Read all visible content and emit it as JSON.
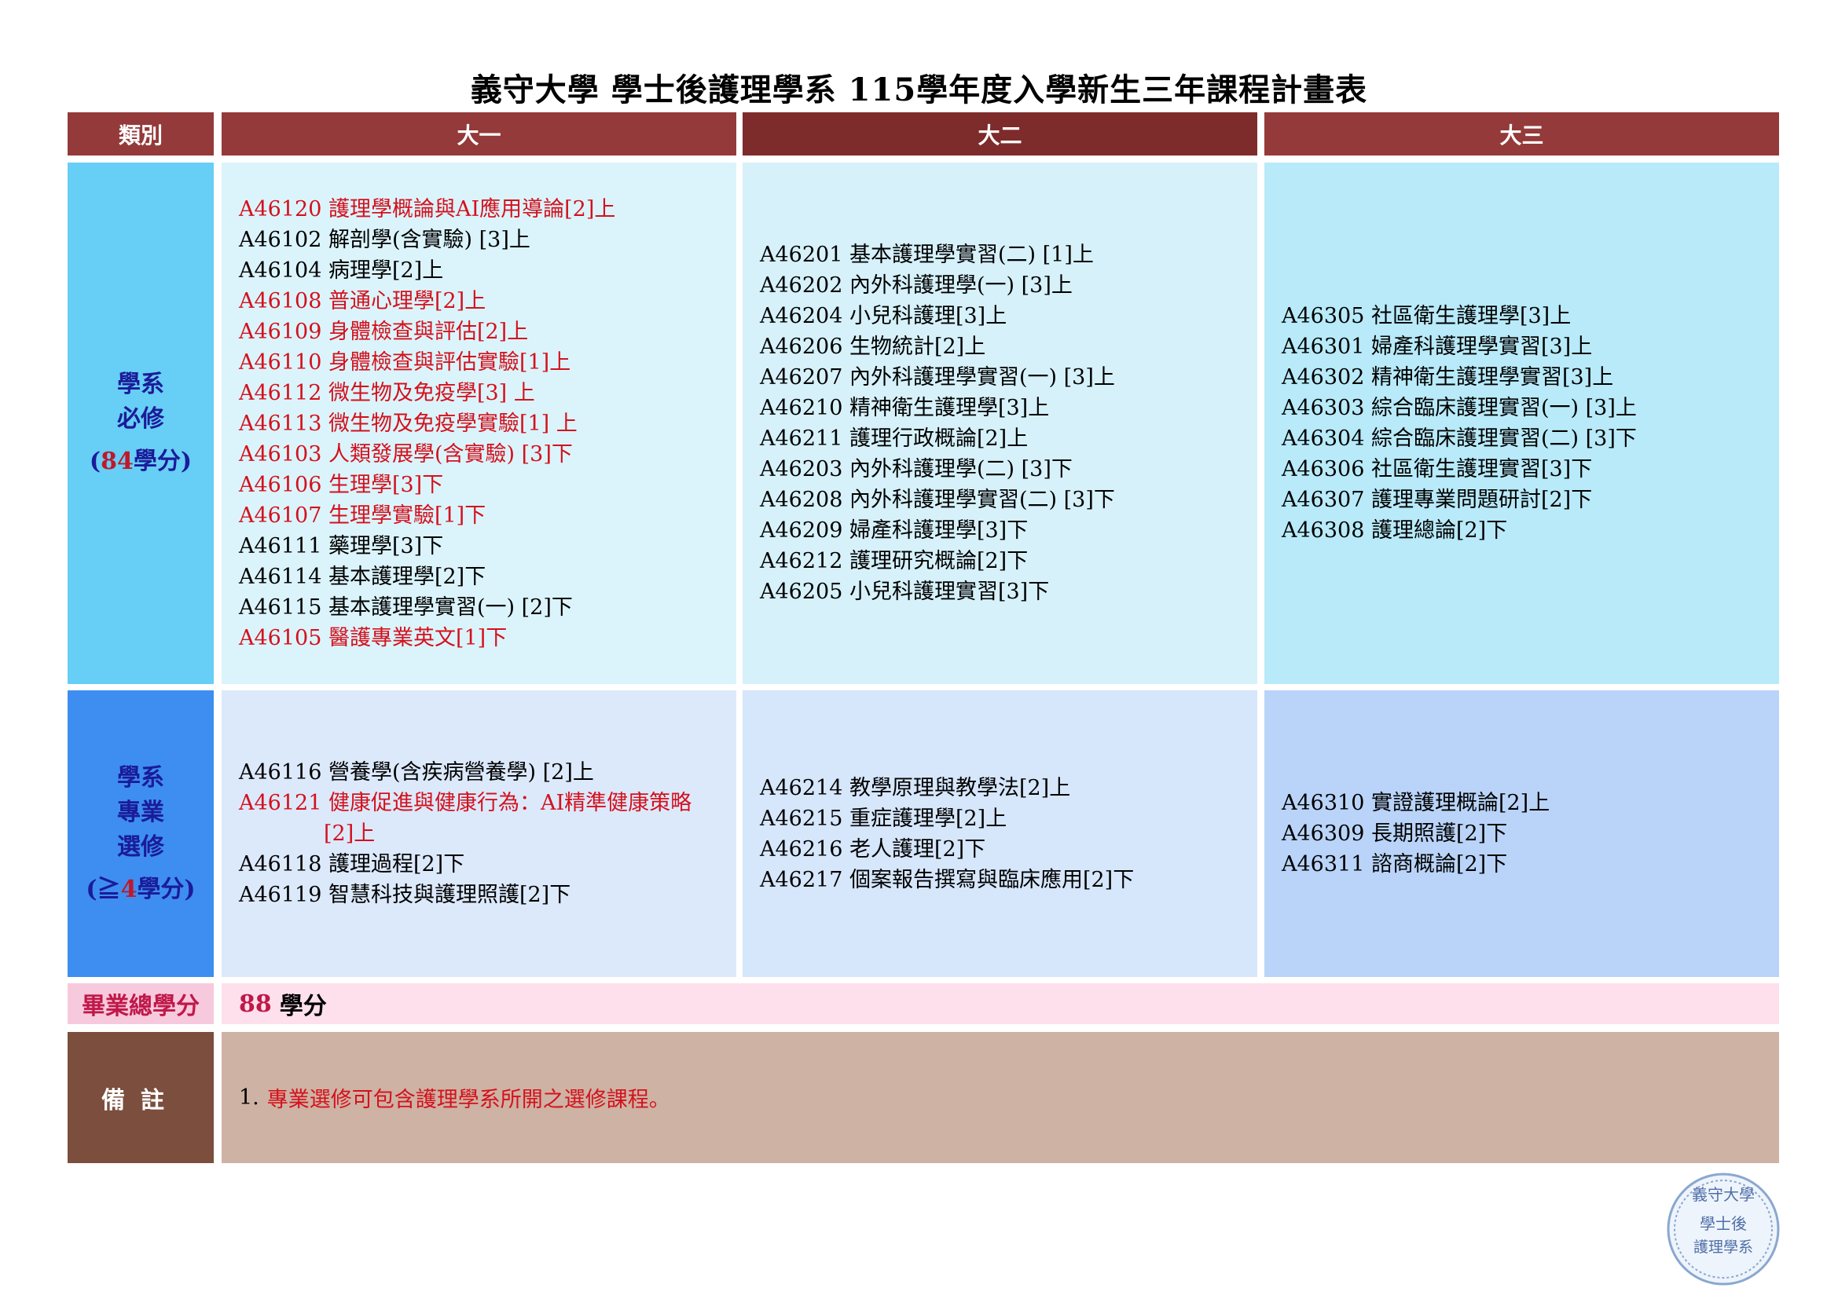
{
  "title": "義守大學 學士後護理學系 115學年度入學新生三年課程計畫表",
  "headers": {
    "category": "類別",
    "year1": "大一",
    "year2": "大二",
    "year3": "大三"
  },
  "required": {
    "label_line1": "學系",
    "label_line2": "必修",
    "credit_open": "(",
    "credit_num": "84",
    "credit_close": "學分)",
    "year1": [
      {
        "text": "A46120 護理學概論與AI應用導論[2]上",
        "red": true
      },
      {
        "text": "A46102 解剖學(含實驗) [3]上",
        "red": false
      },
      {
        "text": "A46104 病理學[2]上",
        "red": false
      },
      {
        "text": "A46108 普通心理學[2]上",
        "red": true
      },
      {
        "text": "A46109 身體檢查與評估[2]上",
        "red": true
      },
      {
        "text": "A46110 身體檢查與評估實驗[1]上",
        "red": true
      },
      {
        "text": "A46112 微生物及免疫學[3] 上",
        "red": true
      },
      {
        "text": "A46113 微生物及免疫學實驗[1] 上",
        "red": true
      },
      {
        "text": "A46103 人類發展學(含實驗) [3]下",
        "red": true
      },
      {
        "text": "A46106 生理學[3]下",
        "red": true
      },
      {
        "text": "A46107 生理學實驗[1]下",
        "red": true
      },
      {
        "text": "A46111 藥理學[3]下",
        "red": false
      },
      {
        "text": "A46114 基本護理學[2]下",
        "red": false
      },
      {
        "text": "A46115 基本護理學實習(一) [2]下",
        "red": false
      },
      {
        "text": "A46105 醫護專業英文[1]下",
        "red": true
      }
    ],
    "year2": [
      {
        "text": "A46201 基本護理學實習(二) [1]上",
        "red": false
      },
      {
        "text": "A46202 內外科護理學(一) [3]上",
        "red": false
      },
      {
        "text": "A46204 小兒科護理[3]上",
        "red": false
      },
      {
        "text": "A46206 生物統計[2]上",
        "red": false
      },
      {
        "text": "A46207 內外科護理學實習(一) [3]上",
        "red": false
      },
      {
        "text": "A46210 精神衛生護理學[3]上",
        "red": false
      },
      {
        "text": "A46211 護理行政概論[2]上",
        "red": false
      },
      {
        "text": "A46203 內外科護理學(二) [3]下",
        "red": false
      },
      {
        "text": "A46208 內外科護理學實習(二) [3]下",
        "red": false
      },
      {
        "text": "A46209 婦產科護理學[3]下",
        "red": false
      },
      {
        "text": "A46212 護理研究概論[2]下",
        "red": false
      },
      {
        "text": "A46205 小兒科護理實習[3]下",
        "red": false
      }
    ],
    "year3": [
      {
        "text": "A46305 社區衛生護理學[3]上",
        "red": false
      },
      {
        "text": "A46301 婦產科護理學實習[3]上",
        "red": false
      },
      {
        "text": "A46302 精神衛生護理學實習[3]上",
        "red": false
      },
      {
        "text": "A46303 綜合臨床護理實習(一) [3]上",
        "red": false
      },
      {
        "text": "A46304 綜合臨床護理實習(二) [3]下",
        "red": false
      },
      {
        "text": "A46306 社區衛生護理實習[3]下",
        "red": false
      },
      {
        "text": "A46307 護理專業問題研討[2]下",
        "red": false
      },
      {
        "text": "A46308 護理總論[2]下",
        "red": false
      }
    ]
  },
  "elective": {
    "label_line1": "學系",
    "label_line2": "專業",
    "label_line3": "選修",
    "credit_open": "(≧",
    "credit_num": "4",
    "credit_close": "學分)",
    "year1": [
      {
        "text": "A46116 營養學(含疾病營養學) [2]上",
        "red": false
      },
      {
        "text": "A46121 健康促進與健康行為：AI精準健康策略[2]上",
        "red": true
      },
      {
        "text": "A46118 護理過程[2]下",
        "red": false
      },
      {
        "text": "A46119 智慧科技與護理照護[2]下",
        "red": false
      }
    ],
    "year2": [
      {
        "text": "A46214 教學原理與教學法[2]上",
        "red": false
      },
      {
        "text": "A46215 重症護理學[2]上",
        "red": false
      },
      {
        "text": "A46216 老人護理[2]下",
        "red": false
      },
      {
        "text": "A46217 個案報告撰寫與臨床應用[2]下",
        "red": false
      }
    ],
    "year3": [
      {
        "text": "A46310 實證護理概論[2]上",
        "red": false
      },
      {
        "text": "A46309 長期照護[2]下",
        "red": false
      },
      {
        "text": "A46311 諮商概論[2]下",
        "red": false
      }
    ]
  },
  "total": {
    "label": "畢業總學分",
    "value_num": "88",
    "value_unit": "學分"
  },
  "notes": {
    "label": "備註",
    "num": "1.",
    "text": "專業選修可包含護理學系所開之選修課程。"
  },
  "seal": {
    "top": "義守大學",
    "middle1": "學士後",
    "middle2": "護理學系"
  },
  "colors": {
    "header": "#943a3a",
    "required_label": "#67cef5",
    "required_y1": "#dbf4fb",
    "required_y2": "#d6f1fa",
    "required_y3": "#b8eaf9",
    "elective_label": "#3d8ef0",
    "elective_y1": "#dce9fb",
    "elective_y2": "#d6e6fb",
    "elective_y3": "#b9d4f8",
    "red_text": "#d4111d"
  }
}
